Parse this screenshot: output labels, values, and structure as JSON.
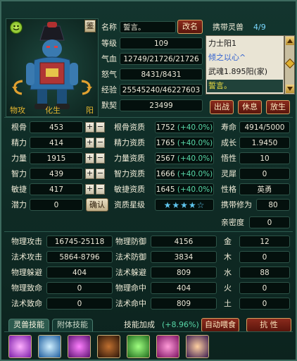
{
  "header": {
    "portrait_menu": "鉴",
    "attack_type": "物攻",
    "evolve": "化生",
    "element": "阳",
    "name_label": "名称",
    "name_value": "誓言。",
    "rename_button": "改名",
    "level_label": "等级",
    "level_value": "109",
    "hp_label": "气血",
    "hp_value": "12749/21726/21726",
    "mp_label": "怒气",
    "mp_value": "8431/8431",
    "exp_label": "经验",
    "exp_value": "25545240/46227603",
    "tacit_label": "默契",
    "tacit_value": "23499"
  },
  "carried": {
    "title": "携带灵兽",
    "count": "4/9",
    "entries": [
      "力士阳1",
      "倾之以心^",
      "武魂1.895阳(家)",
      "誓言。"
    ],
    "fight_button": "出战",
    "rest_button": "休息",
    "release_button": "放生"
  },
  "attributes": [
    {
      "label": "根骨",
      "value": "453"
    },
    {
      "label": "精力",
      "value": "414"
    },
    {
      "label": "力量",
      "value": "1915"
    },
    {
      "label": "智力",
      "value": "439"
    },
    {
      "label": "敏捷",
      "value": "417"
    }
  ],
  "potential": {
    "label": "潜力",
    "value": "0",
    "confirm_button": "确认"
  },
  "aptitudes": [
    {
      "label": "根骨资质",
      "value": "1752",
      "bonus": "(+40.0%)"
    },
    {
      "label": "精力资质",
      "value": "1765",
      "bonus": "(+40.0%)"
    },
    {
      "label": "力量资质",
      "value": "2567",
      "bonus": "(+40.0%)"
    },
    {
      "label": "智力资质",
      "value": "1666",
      "bonus": "(+40.0%)"
    },
    {
      "label": "敏捷资质",
      "value": "1645",
      "bonus": "(+40.0%)"
    }
  ],
  "aptitude_star": {
    "label": "资质星级",
    "stars": "★★★★☆"
  },
  "right_stats": [
    {
      "label": "寿命",
      "value": "4914/5000"
    },
    {
      "label": "成长",
      "value": "1.9450"
    },
    {
      "label": "悟性",
      "value": "10"
    },
    {
      "label": "灵犀",
      "value": "0"
    },
    {
      "label": "性格",
      "value": "英勇"
    }
  ],
  "cultivation": {
    "label": "携带修为",
    "value": "80"
  },
  "intimacy": {
    "label": "亲密度",
    "value": "0"
  },
  "combat": [
    {
      "label1": "物理攻击",
      "value1": "16745-25118",
      "label2": "物理防御",
      "value2": "4156",
      "label3": "金",
      "value3": "12"
    },
    {
      "label1": "法术攻击",
      "value1": "5864-8796",
      "label2": "法术防御",
      "value2": "3834",
      "label3": "木",
      "value3": "0"
    },
    {
      "label1": "物理躲避",
      "value1": "404",
      "label2": "法术躲避",
      "value2": "809",
      "label3": "水",
      "value3": "88"
    },
    {
      "label1": "物理致命",
      "value1": "0",
      "label2": "物理命中",
      "value2": "404",
      "label3": "火",
      "value3": "0"
    },
    {
      "label1": "法术致命",
      "value1": "0",
      "label2": "法术命中",
      "value2": "809",
      "label3": "土",
      "value3": "0"
    }
  ],
  "tabs": [
    "灵兽技能",
    "附体技能"
  ],
  "skill_bonus": {
    "label": "技能加成",
    "value": "(+8.96%)"
  },
  "auto_feed_button": "自动喂食",
  "resist_button": "抗 性",
  "skills": [
    "skill-icon-1",
    "skill-icon-2",
    "skill-icon-3",
    "skill-icon-4",
    "skill-icon-5",
    "skill-icon-6",
    "skill-icon-7",
    "skill-icon-8",
    "skill-icon-9",
    "skill-icon-10",
    "skill-icon-11"
  ]
}
